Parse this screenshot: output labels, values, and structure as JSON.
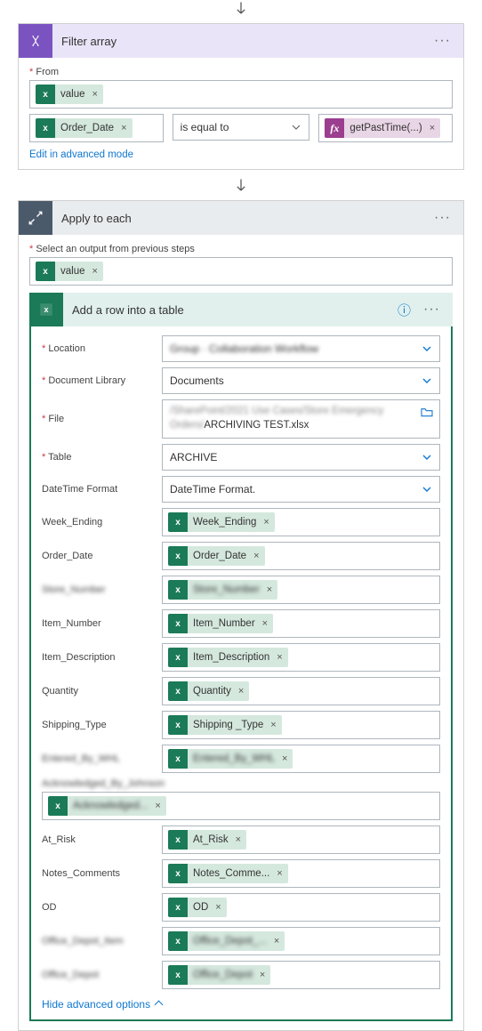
{
  "filter": {
    "title": "Filter array",
    "from_label": "From",
    "from_token": "value",
    "left_token": "Order_Date",
    "operator": "is equal to",
    "right_token": "getPastTime(...)",
    "advanced_link": "Edit in advanced mode"
  },
  "apply": {
    "title": "Apply to each",
    "select_label": "Select an output from previous steps",
    "select_token": "value"
  },
  "addrow": {
    "title": "Add a row into a table",
    "loc_label": "Location",
    "loc_value": "Group · Collaboration Workflow",
    "lib_label": "Document Library",
    "lib_value": "Documents",
    "file_label": "File",
    "file_value_blur": "/SharePoint/2021 Use Cases/Store Emergency Orders/",
    "file_value_suffix": "ARCHIVING TEST.xlsx",
    "table_label": "Table",
    "table_value": "ARCHIVE",
    "dt_label": "DateTime Format",
    "dt_value": "DateTime Format.",
    "fields": [
      {
        "label": "Week_Ending",
        "token": "Week_Ending"
      },
      {
        "label": "Order_Date",
        "token": "Order_Date"
      },
      {
        "label": "Store_Number",
        "token": "Store_Number",
        "blur": true
      },
      {
        "label": "Item_Number",
        "token": "Item_Number"
      },
      {
        "label": "Item_Description",
        "token": "Item_Description"
      },
      {
        "label": "Quantity",
        "token": "Quantity"
      },
      {
        "label": "Shipping_Type",
        "token": "Shipping _Type"
      },
      {
        "label": "Entered_By_WHL",
        "token": "Entered_By_WHL",
        "blur": true
      }
    ],
    "ack_label": "Acknowledged_By_Johnson",
    "ack_token": "Acknowledged...",
    "fields2": [
      {
        "label": "At_Risk",
        "token": "At_Risk"
      },
      {
        "label": "Notes_Comments",
        "token": "Notes_Comme..."
      },
      {
        "label": "OD",
        "token": "OD"
      },
      {
        "label": "Office_Depot_Item",
        "token": "Office_Depot_...",
        "blur": true
      },
      {
        "label": "Office_Depot",
        "token": "Office_Depot",
        "blur": true
      }
    ],
    "hide_link": "Hide advanced options"
  }
}
